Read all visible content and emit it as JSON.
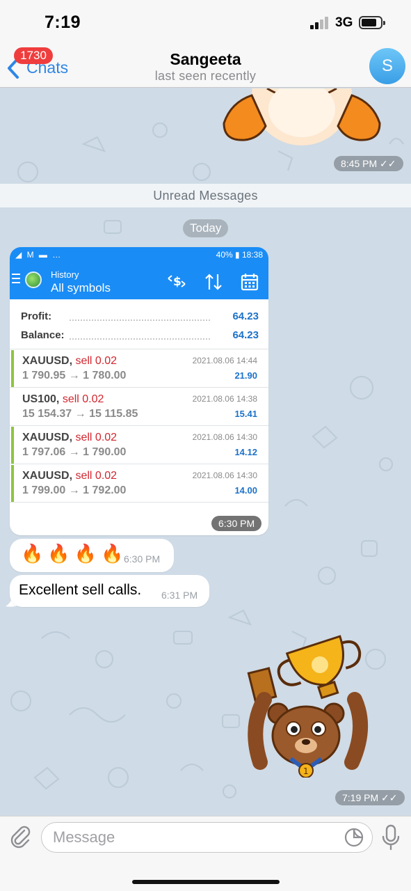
{
  "status_bar": {
    "time": "7:19",
    "network": "3G"
  },
  "header": {
    "back_label": "Chats",
    "unread_count": "1730",
    "title": "Sangeeta",
    "subtitle": "last seen recently",
    "avatar_letter": "S"
  },
  "chat": {
    "sticker1_time": "8:45 PM",
    "unread_divider": "Unread Messages",
    "date_pill": "Today",
    "screenshot": {
      "status_left": "◢ M ▬ …",
      "status_right": "40% ▮ 18:38",
      "toolbar_subtitle": "History",
      "toolbar_title": "All symbols",
      "summary": [
        {
          "label": "Profit:",
          "value": "64.23"
        },
        {
          "label": "Balance:",
          "value": "64.23"
        }
      ],
      "deals": [
        {
          "symbol": "XAUUSD,",
          "action": "sell 0.02",
          "prices": "1 790.95 → 1 780.00",
          "date": "2021.08.06 14:44",
          "profit": "21.90",
          "marked": true
        },
        {
          "symbol": "US100,",
          "action": "sell 0.02",
          "prices": "15 154.37 → 15 115.85",
          "date": "2021.08.06 14:38",
          "profit": "15.41",
          "marked": false
        },
        {
          "symbol": "XAUUSD,",
          "action": "sell 0.02",
          "prices": "1 797.06 → 1 790.00",
          "date": "2021.08.06 14:30",
          "profit": "14.12",
          "marked": true
        },
        {
          "symbol": "XAUUSD,",
          "action": "sell 0.02",
          "prices": "1 799.00 → 1 792.00",
          "date": "2021.08.06 14:30",
          "profit": "14.00",
          "marked": true
        }
      ],
      "time": "6:30 PM"
    },
    "fire_message": {
      "text": "🔥🔥🔥🔥",
      "time": "6:30 PM"
    },
    "text_message": {
      "text": "Excellent sell calls.",
      "time": "6:31 PM"
    },
    "sticker2_time": "7:19 PM"
  },
  "input": {
    "placeholder": "Message"
  },
  "colors": {
    "accent": "#2f86e6",
    "badge": "#ef3d3d",
    "mt_blue": "#1a8cf5",
    "sell_red": "#d1262e",
    "profit_blue": "#1b72c9",
    "chat_bg": "#cfdbe6"
  }
}
